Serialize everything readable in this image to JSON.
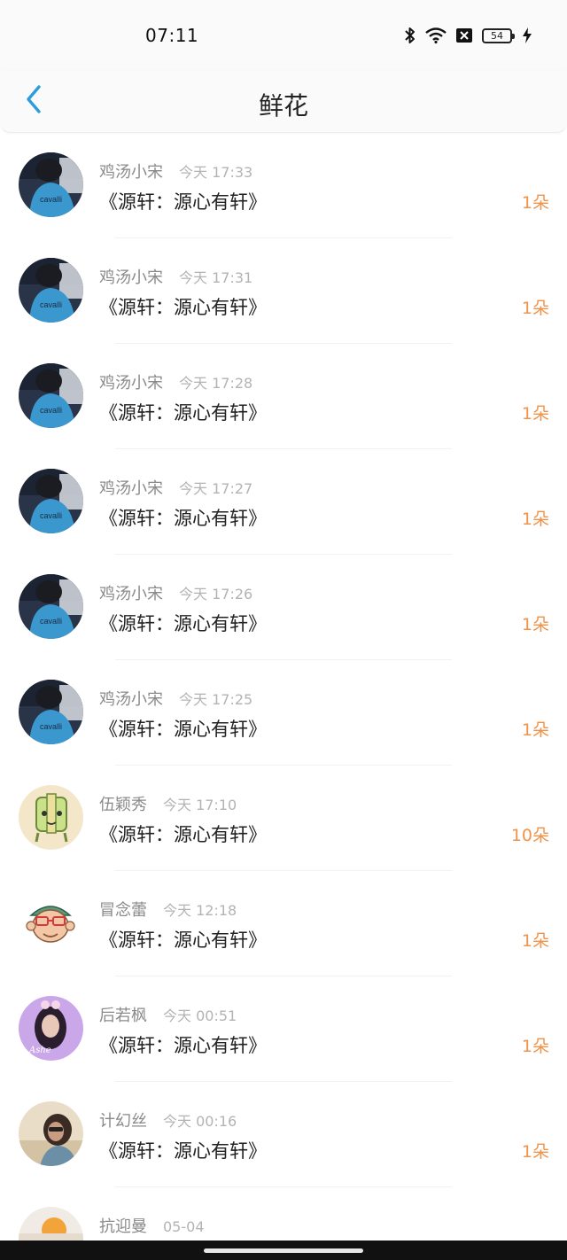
{
  "status_bar": {
    "time": "07:11",
    "battery_level": "54",
    "icons": [
      "bluetooth-icon",
      "wifi-icon",
      "sim-disabled-icon",
      "battery-icon",
      "charging-icon"
    ]
  },
  "nav": {
    "title": "鲜花",
    "back_icon": "chevron-left-icon",
    "accent_color": "#2d9cdb"
  },
  "list": {
    "qty_color": "#f0934a",
    "items": [
      {
        "sender": "鸡汤小宋",
        "time": "今天 17:33",
        "title": "《源轩：源心有轩》",
        "qty": "1朵",
        "avatar": "photo-blue-shirt"
      },
      {
        "sender": "鸡汤小宋",
        "time": "今天 17:31",
        "title": "《源轩：源心有轩》",
        "qty": "1朵",
        "avatar": "photo-blue-shirt"
      },
      {
        "sender": "鸡汤小宋",
        "time": "今天 17:28",
        "title": "《源轩：源心有轩》",
        "qty": "1朵",
        "avatar": "photo-blue-shirt"
      },
      {
        "sender": "鸡汤小宋",
        "time": "今天 17:27",
        "title": "《源轩：源心有轩》",
        "qty": "1朵",
        "avatar": "photo-blue-shirt"
      },
      {
        "sender": "鸡汤小宋",
        "time": "今天 17:26",
        "title": "《源轩：源心有轩》",
        "qty": "1朵",
        "avatar": "photo-blue-shirt"
      },
      {
        "sender": "鸡汤小宋",
        "time": "今天 17:25",
        "title": "《源轩：源心有轩》",
        "qty": "1朵",
        "avatar": "photo-blue-shirt"
      },
      {
        "sender": "伍颖秀",
        "time": "今天 17:10",
        "title": "《源轩：源心有轩》",
        "qty": "10朵",
        "avatar": "cartoon-green-character"
      },
      {
        "sender": "冒念蕾",
        "time": "今天 12:18",
        "title": "《源轩：源心有轩》",
        "qty": "1朵",
        "avatar": "cartoon-monkey-glasses"
      },
      {
        "sender": "后若枫",
        "time": "今天 00:51",
        "title": "《源轩：源心有轩》",
        "qty": "1朵",
        "avatar": "photo-girl-purple"
      },
      {
        "sender": "计幻丝",
        "time": "今天 00:16",
        "title": "《源轩：源心有轩》",
        "qty": "1朵",
        "avatar": "photo-girl-beach"
      },
      {
        "sender": "抗迎曼",
        "time": "05-04",
        "title": "",
        "qty": "",
        "avatar": "photo-sunset-partial"
      }
    ]
  }
}
